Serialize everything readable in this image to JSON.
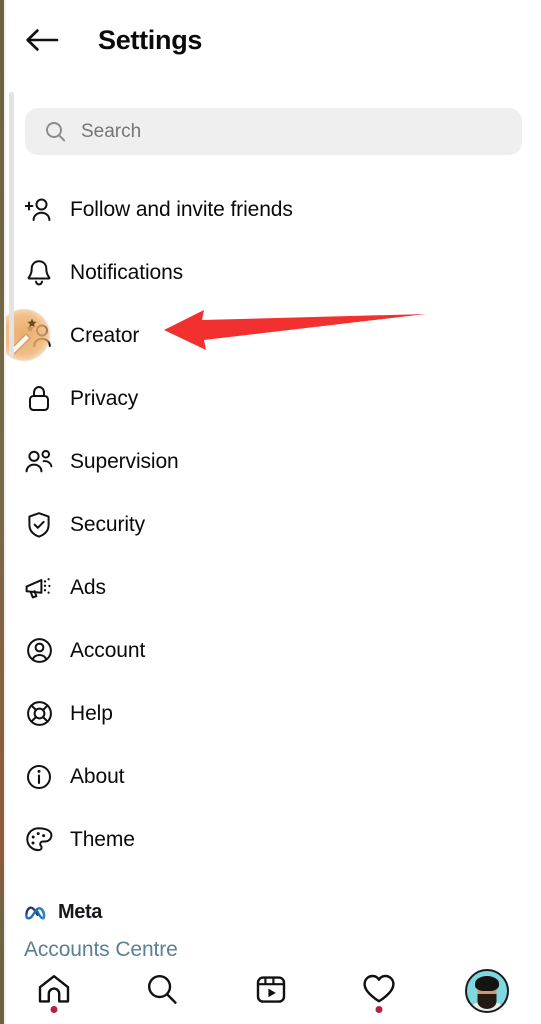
{
  "header": {
    "back_icon": "back-arrow-icon",
    "title": "Settings"
  },
  "search": {
    "icon": "search-icon",
    "placeholder": "Search",
    "value": ""
  },
  "menu": {
    "items": [
      {
        "label": "Follow and invite friends",
        "icon": "person-add-icon"
      },
      {
        "label": "Notifications",
        "icon": "bell-icon"
      },
      {
        "label": "Creator",
        "icon": "creator-star-person-icon"
      },
      {
        "label": "Privacy",
        "icon": "lock-icon"
      },
      {
        "label": "Supervision",
        "icon": "two-people-icon"
      },
      {
        "label": "Security",
        "icon": "shield-check-icon"
      },
      {
        "label": "Ads",
        "icon": "megaphone-icon"
      },
      {
        "label": "Account",
        "icon": "person-circle-icon"
      },
      {
        "label": "Help",
        "icon": "lifebuoy-icon"
      },
      {
        "label": "About",
        "icon": "info-circle-icon"
      },
      {
        "label": "Theme",
        "icon": "palette-icon"
      }
    ]
  },
  "footer": {
    "brand_logo": "meta-infinity-logo",
    "brand_name": "Meta",
    "accounts_centre": "Accounts Centre"
  },
  "annotation": {
    "arrow": "red-left-arrow",
    "target_label": "Creator",
    "color": "#f23030"
  },
  "tap_indicator": {
    "icon": "magic-wand-cursor-icon",
    "color": "#e9a65e"
  },
  "bottom_nav": {
    "items": [
      {
        "name": "home",
        "icon": "home-icon",
        "badge": true
      },
      {
        "name": "search",
        "icon": "search-icon",
        "badge": false
      },
      {
        "name": "reels",
        "icon": "reels-icon",
        "badge": false
      },
      {
        "name": "activity",
        "icon": "heart-icon",
        "badge": true
      },
      {
        "name": "profile",
        "icon": "avatar-icon",
        "badge": false
      }
    ],
    "badge_color": "#b3213f"
  },
  "colors": {
    "background": "#ffffff",
    "text": "#0a0a0a",
    "search_bg": "#efefef",
    "placeholder": "#767676",
    "link": "#5b7f93",
    "accent_red": "#f23030"
  }
}
